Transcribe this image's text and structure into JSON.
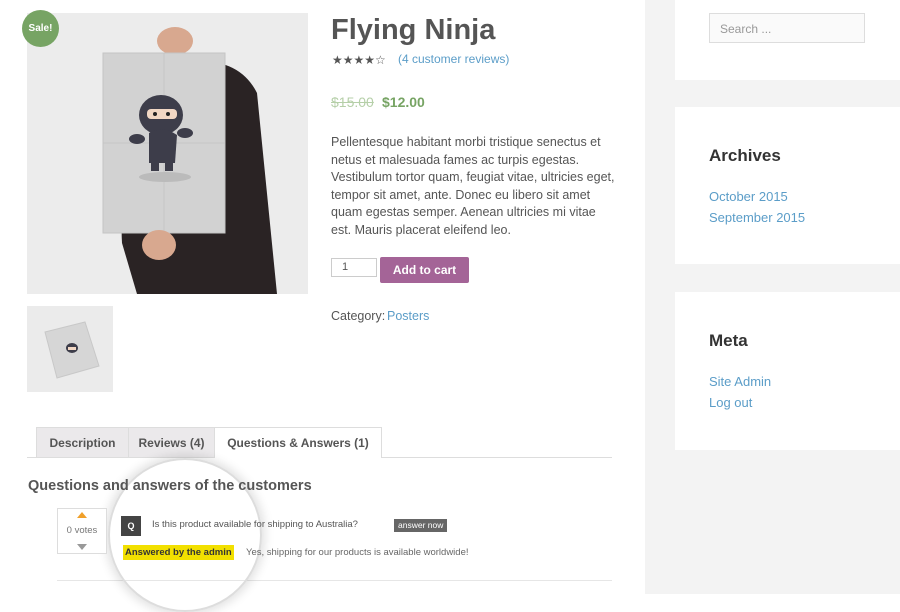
{
  "product": {
    "sale_badge": "Sale!",
    "title": "Flying Ninja",
    "rating": 4,
    "stars": "★★★★☆",
    "reviews_link": "(4 customer reviews)",
    "old_price": "$15.00",
    "new_price": "$12.00",
    "description": "Pellentesque habitant morbi tristique senectus et netus et malesuada fames ac turpis egestas. Vestibulum tortor quam, feugiat vitae, ultricies eget, tempor sit amet, ante. Donec eu libero sit amet quam egestas semper. Aenean ultricies mi vitae est. Mauris placerat eleifend leo.",
    "quantity": "1",
    "add_to_cart": "Add to cart",
    "category_label": "Category:",
    "category_link": "Posters"
  },
  "tabs": [
    {
      "label": "Description"
    },
    {
      "label": "Reviews (4)"
    },
    {
      "label": "Questions & Answers (1)",
      "active": true
    }
  ],
  "qa": {
    "heading": "Questions and answers of the customers",
    "votes": "0 votes",
    "question_badge": "Q",
    "question": "Is this product available for shipping to Australia?",
    "answer_now": "answer now",
    "answered_by": "Answered by the admin",
    "answer": "Yes, shipping for our products is available worldwide!"
  },
  "sidebar": {
    "search_placeholder": "Search ...",
    "archives_title": "Archives",
    "archives": [
      "October 2015",
      "September 2015"
    ],
    "meta_title": "Meta",
    "meta_links": [
      "Site Admin",
      "Log out"
    ]
  },
  "colors": {
    "sale": "#77a464",
    "price": "#77a464",
    "button": "#a46497",
    "link": "#5b9dc8",
    "highlight": "#f2e000"
  }
}
